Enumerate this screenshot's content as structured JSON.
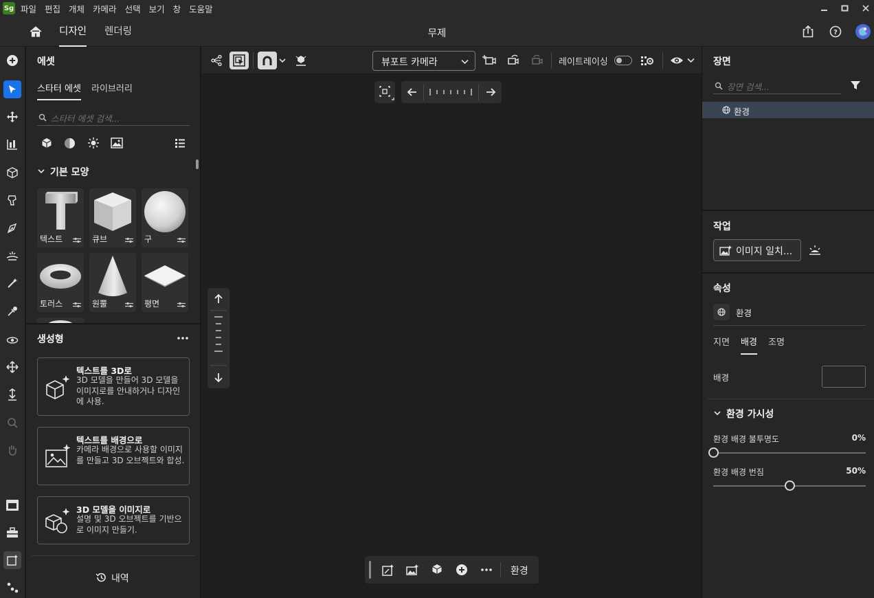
{
  "app": {
    "logo": "Sg",
    "menu": [
      "파일",
      "편집",
      "개체",
      "카메라",
      "선택",
      "보기",
      "창",
      "도움말"
    ],
    "window_controls": [
      "minimize-icon",
      "maximize-icon",
      "close-icon"
    ]
  },
  "topnav": {
    "tabs": [
      "디자인",
      "렌더링"
    ],
    "active_tab": "디자인",
    "title": "무제",
    "icons": [
      "home-icon",
      "share-icon",
      "help-icon",
      "user-avatar-icon"
    ]
  },
  "toolbar": {
    "tools": [
      "add-icon",
      "select-icon",
      "move-icon",
      "align-icon",
      "object-icon",
      "material-icon",
      "pen-icon",
      "ground-icon",
      "magic-wand-icon",
      "eyedropper-icon",
      "orbit-icon",
      "pan-icon",
      "dolly-icon",
      "zoom-icon",
      "hand-icon",
      "archive-icon",
      "toolbox-icon",
      "generate-icon",
      "graph-icon"
    ],
    "active": "select-icon"
  },
  "assets": {
    "title": "에셋",
    "tabs": [
      "스타터 에셋",
      "라이브러리"
    ],
    "active_tab": "스타터 에셋",
    "search_placeholder": "스타터 에셋 검색...",
    "filter_icons": [
      "model-icon",
      "material-icon",
      "light-icon",
      "image-icon",
      "list-view-icon"
    ],
    "section": "기본 모양",
    "shapes": [
      {
        "label": "텍스트"
      },
      {
        "label": "큐브"
      },
      {
        "label": "구"
      },
      {
        "label": "토러스"
      },
      {
        "label": "원뿔"
      },
      {
        "label": "평면"
      }
    ]
  },
  "generative": {
    "title": "생성형",
    "cards": [
      {
        "title": "텍스트를 3D로",
        "desc": "3D 모델을 만들어 3D 모델을 이미지로를 안내하거나 디자인에 사용."
      },
      {
        "title": "텍스트를 배경으로",
        "desc": "카메라 배경으로 사용할 이미지를 만들고 3D 오브젝트와 합성."
      },
      {
        "title": "3D 모델을 이미지로",
        "desc": "설명 및 3D 오브젝트를 기반으로 이미지 만들기."
      }
    ],
    "history_label": "내역"
  },
  "viewport": {
    "camera_select": "뷰포트 카메라",
    "raytracing_label": "레이트레이싱",
    "raytracing_on": false,
    "bottom_label": "환경"
  },
  "scene": {
    "title": "장면",
    "search_placeholder": "장면 검색...",
    "items": [
      {
        "label": "환경",
        "selected": true
      }
    ]
  },
  "actions": {
    "title": "작업",
    "match_image_label": "이미지 일치..."
  },
  "properties": {
    "title": "속성",
    "object_label": "환경",
    "tabs": [
      "지면",
      "배경",
      "조명"
    ],
    "active_tab": "배경",
    "background_label": "배경",
    "background_color": "#262626",
    "visibility_section": "환경 가시성",
    "opacity_label": "환경 배경 불투명도",
    "opacity_value": "0%",
    "opacity": 0,
    "blur_label": "환경 배경 번짐",
    "blur_value": "50%",
    "blur": 0.5
  }
}
